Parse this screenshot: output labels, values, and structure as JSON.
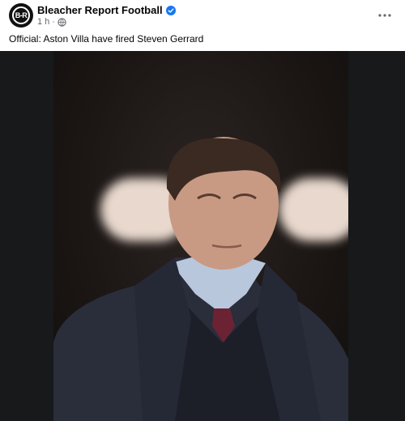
{
  "post": {
    "page_name": "Bleacher Report Football",
    "avatar_text": "B-R",
    "time": "1 h",
    "dot": "·",
    "caption": "Official: Aston Villa have fired Steven Gerrard"
  },
  "icons": {
    "verified": "verified-badge-icon",
    "audience": "globe-icon",
    "more": "more-options-icon"
  },
  "colors": {
    "verified_blue": "#1877f2",
    "secondary_text": "#65676b",
    "media_background": "#18191b"
  }
}
